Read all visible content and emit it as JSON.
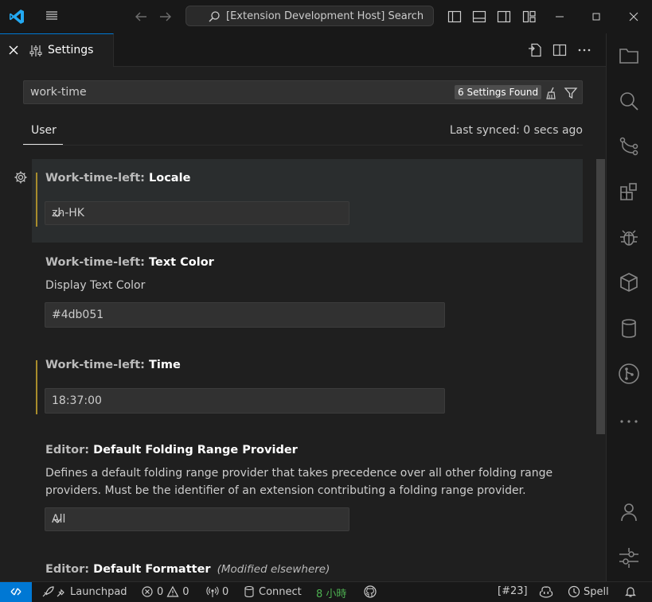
{
  "titlebar": {
    "search_text": "[Extension Development Host] Search"
  },
  "tab": {
    "label": "Settings"
  },
  "settings": {
    "query": "work-time",
    "found_badge": "6 Settings Found",
    "scope_tab": "User",
    "last_synced": "Last synced: 0 secs ago",
    "items": [
      {
        "category": "Work-time-left: ",
        "key": "Locale",
        "value": "zh-HK"
      },
      {
        "category": "Work-time-left: ",
        "key": "Text Color",
        "description": "Display Text Color",
        "value": "#4db051"
      },
      {
        "category": "Work-time-left: ",
        "key": "Time",
        "value": "18:37:00"
      },
      {
        "category": "Editor: ",
        "key": "Default Folding Range Provider",
        "description": "Defines a default folding range provider that takes precedence over all other folding range providers. Must be the identifier of an extension contributing a folding range provider.",
        "value": "All"
      },
      {
        "category": "Editor: ",
        "key": "Default Formatter",
        "modified": "(Modified elsewhere)"
      }
    ]
  },
  "statusbar": {
    "launchpad": "Launchpad",
    "errors": "0",
    "warnings": "0",
    "ports": "0",
    "connect": "Connect",
    "work_time": "8 小時",
    "pr": "[#23]",
    "spell": "Spell"
  },
  "colors": {
    "accent": "#0078d4",
    "modified_bar": "#a88c2c",
    "worktime_green": "#4db051"
  }
}
